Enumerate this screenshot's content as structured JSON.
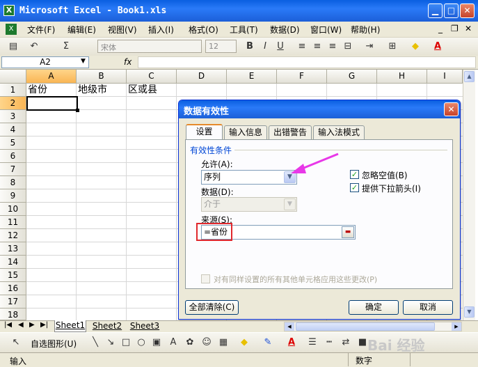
{
  "window": {
    "title": "Microsoft Excel - Book1.xls",
    "app_icon": "X"
  },
  "menu": {
    "items": [
      "文件(F)",
      "编辑(E)",
      "视图(V)",
      "插入(I)",
      "格式(O)",
      "工具(T)",
      "数据(D)",
      "窗口(W)",
      "帮助(H)"
    ]
  },
  "toolbar": {
    "font": "宋体",
    "size": "12",
    "bold": "B",
    "italic": "I",
    "underline": "U",
    "sigma": "Σ"
  },
  "formula": {
    "namebox": "A2",
    "fx": "fx"
  },
  "columns": [
    "A",
    "B",
    "C",
    "D",
    "E",
    "F",
    "G",
    "H",
    "I"
  ],
  "rows": [
    "1",
    "2",
    "3",
    "4",
    "5",
    "6",
    "7",
    "8",
    "9",
    "10",
    "11",
    "12",
    "13",
    "14",
    "15",
    "16",
    "17",
    "18"
  ],
  "cells": {
    "a1": "省份",
    "b1": "地级市",
    "c1": "区或县"
  },
  "sheets": [
    "Sheet1",
    "Sheet2",
    "Sheet3"
  ],
  "drawbar": {
    "autoshapes": "自选图形(U)"
  },
  "status": {
    "mode": "输入",
    "num": "数字"
  },
  "dialog": {
    "title": "数据有效性",
    "tabs": [
      "设置",
      "输入信息",
      "出错警告",
      "输入法模式"
    ],
    "group": "有效性条件",
    "allow_label": "允许(A):",
    "allow_value": "序列",
    "data_label": "数据(D):",
    "data_value": "介于",
    "ignore_blank": "忽略空值(B)",
    "dropdown": "提供下拉箭头(I)",
    "source_label": "来源(S):",
    "source_value": "=省份",
    "apply_all": "对有同样设置的所有其他单元格应用这些更改(P)",
    "clear_all": "全部清除(C)",
    "ok": "确定",
    "cancel": "取消"
  },
  "watermark": {
    "text": "Bai 经验"
  },
  "colors": {
    "title_blue": "#0a5fe0",
    "highlight_red": "#e0282d",
    "arrow_magenta": "#e838e8"
  }
}
